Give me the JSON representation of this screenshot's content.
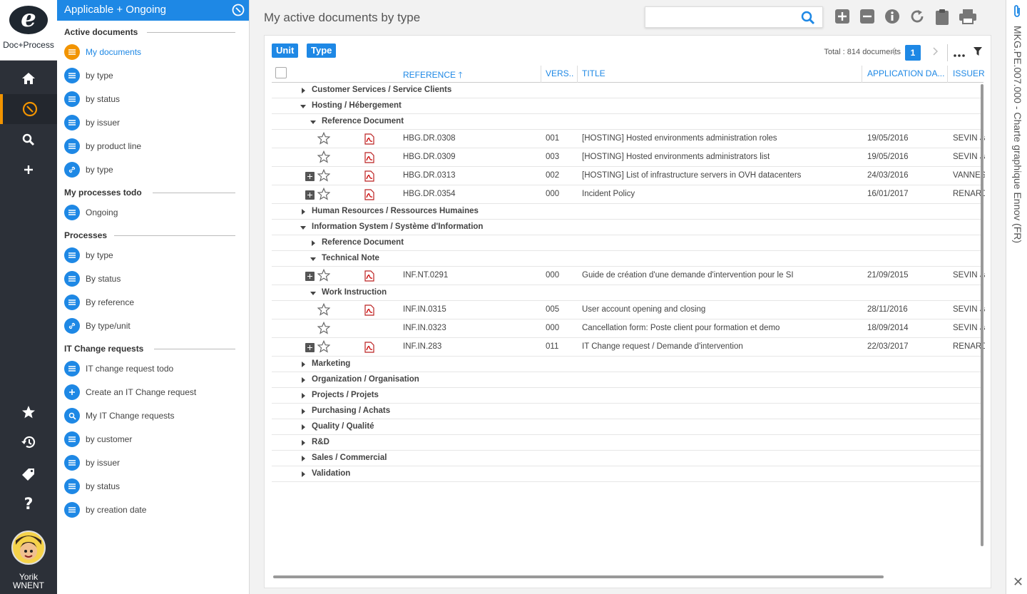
{
  "app": {
    "logo_text": "Doc+Process",
    "user_first": "Yorik",
    "user_last": "WNENT"
  },
  "panel": {
    "header": "Applicable + Ongoing",
    "sections": [
      {
        "title": "Active documents",
        "items": [
          "My documents",
          "by type",
          "by status",
          "by issuer",
          "by product line",
          "by type"
        ]
      },
      {
        "title": "My processes todo",
        "items": [
          "Ongoing"
        ]
      },
      {
        "title": "Processes",
        "items": [
          "by type",
          "By status",
          "By reference",
          "By type/unit"
        ]
      },
      {
        "title": "IT Change requests",
        "items": [
          "IT change request todo",
          "Create an IT Change request",
          "My IT Change requests",
          "by customer",
          "by issuer",
          "by status",
          "by creation date"
        ]
      }
    ]
  },
  "main": {
    "title": "My active documents by type",
    "search_placeholder": "",
    "pills": {
      "unit": "Unit",
      "type": "Type"
    },
    "total": "Total : 814 documents",
    "page": "1",
    "columns": {
      "reference": "REFERENCE",
      "version": "VERS..",
      "title": "TITLE",
      "application_date": "APPLICATION DA...",
      "issuer": "ISSUER"
    },
    "groups": [
      "Customer Services / Service Clients",
      "Hosting / Hébergement",
      "Reference Document",
      "Human Resources / Ressources Humaines",
      "Information System / Système d'Information",
      "Reference Document",
      "Technical Note",
      "Work Instruction",
      "Marketing",
      "Organization / Organisation",
      "Projects / Projets",
      "Purchasing / Achats",
      "Quality / Qualité",
      "R&D",
      "Sales / Commercial",
      "Validation"
    ],
    "docs": [
      {
        "ref": "HBG.DR.0308",
        "ver": "001",
        "title": "[HOSTING] Hosted environments administration roles",
        "date": "19/05/2016",
        "issuer": "SEVIN Jac"
      },
      {
        "ref": "HBG.DR.0309",
        "ver": "003",
        "title": "[HOSTING] Hosted environments administrators list",
        "date": "19/05/2016",
        "issuer": "SEVIN Jac"
      },
      {
        "ref": "HBG.DR.0313",
        "ver": "002",
        "title": "[HOSTING] List of infrastructure servers in OVH datacenters",
        "date": "24/03/2016",
        "issuer": "VANNEST"
      },
      {
        "ref": "HBG.DR.0354",
        "ver": "000",
        "title": "Incident Policy",
        "date": "16/01/2017",
        "issuer": "RENARD"
      },
      {
        "ref": "INF.NT.0291",
        "ver": "000",
        "title": "Guide de création d'une demande d'intervention pour le SI",
        "date": "21/09/2015",
        "issuer": "SEVIN Jac"
      },
      {
        "ref": "INF.IN.0315",
        "ver": "005",
        "title": "User account opening and closing",
        "date": "28/11/2016",
        "issuer": "SEVIN Jac"
      },
      {
        "ref": "INF.IN.0323",
        "ver": "000",
        "title": "Cancellation form: Poste client pour formation et demo",
        "date": "18/09/2014",
        "issuer": "SEVIN Jac"
      },
      {
        "ref": "INF.IN.283",
        "ver": "011",
        "title": "IT Change request / Demande d'intervention",
        "date": "22/03/2017",
        "issuer": "RENARD"
      }
    ]
  },
  "right_panel": {
    "doc_label": "MKG.PE.007.000 - Charte graphique Ennov (FR)"
  },
  "colors": {
    "accent": "#1e88e5",
    "active": "#f29400",
    "rail": "#2c3038"
  }
}
